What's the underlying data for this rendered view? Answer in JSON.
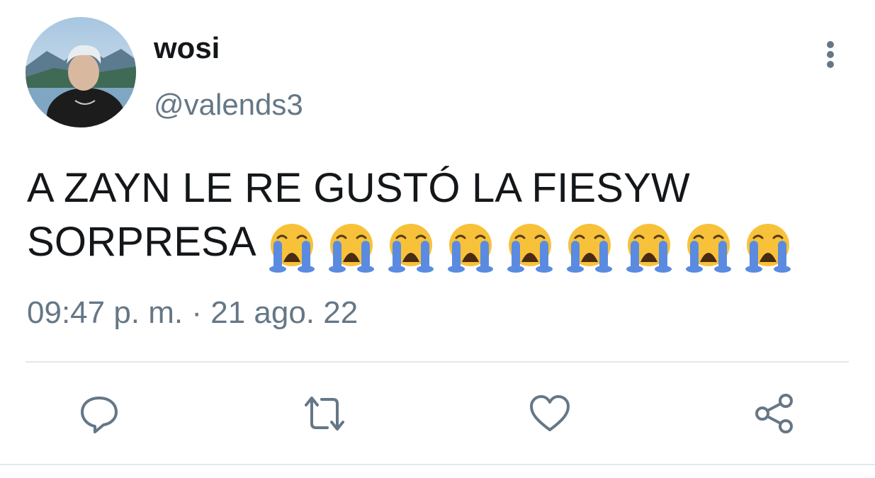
{
  "tweet": {
    "display_name": "wosi",
    "handle": "@valends3",
    "text_line1": "A ZAYN LE RE GUSTÓ LA FIESYW",
    "text_line2": "SORPRESA",
    "emoji": [
      "😭",
      "😭",
      "😭",
      "😭",
      "😭",
      "😭",
      "😭",
      "😭",
      "😭"
    ],
    "timestamp": "09:47 p. m. · 21 ago. 22"
  },
  "icons": {
    "more": "more-vertical-icon",
    "reply": "reply-icon",
    "retweet": "retweet-icon",
    "like": "heart-icon",
    "share": "share-icon"
  },
  "colors": {
    "text": "#14171a",
    "secondary": "#657786",
    "divider": "#e1e8ed"
  }
}
